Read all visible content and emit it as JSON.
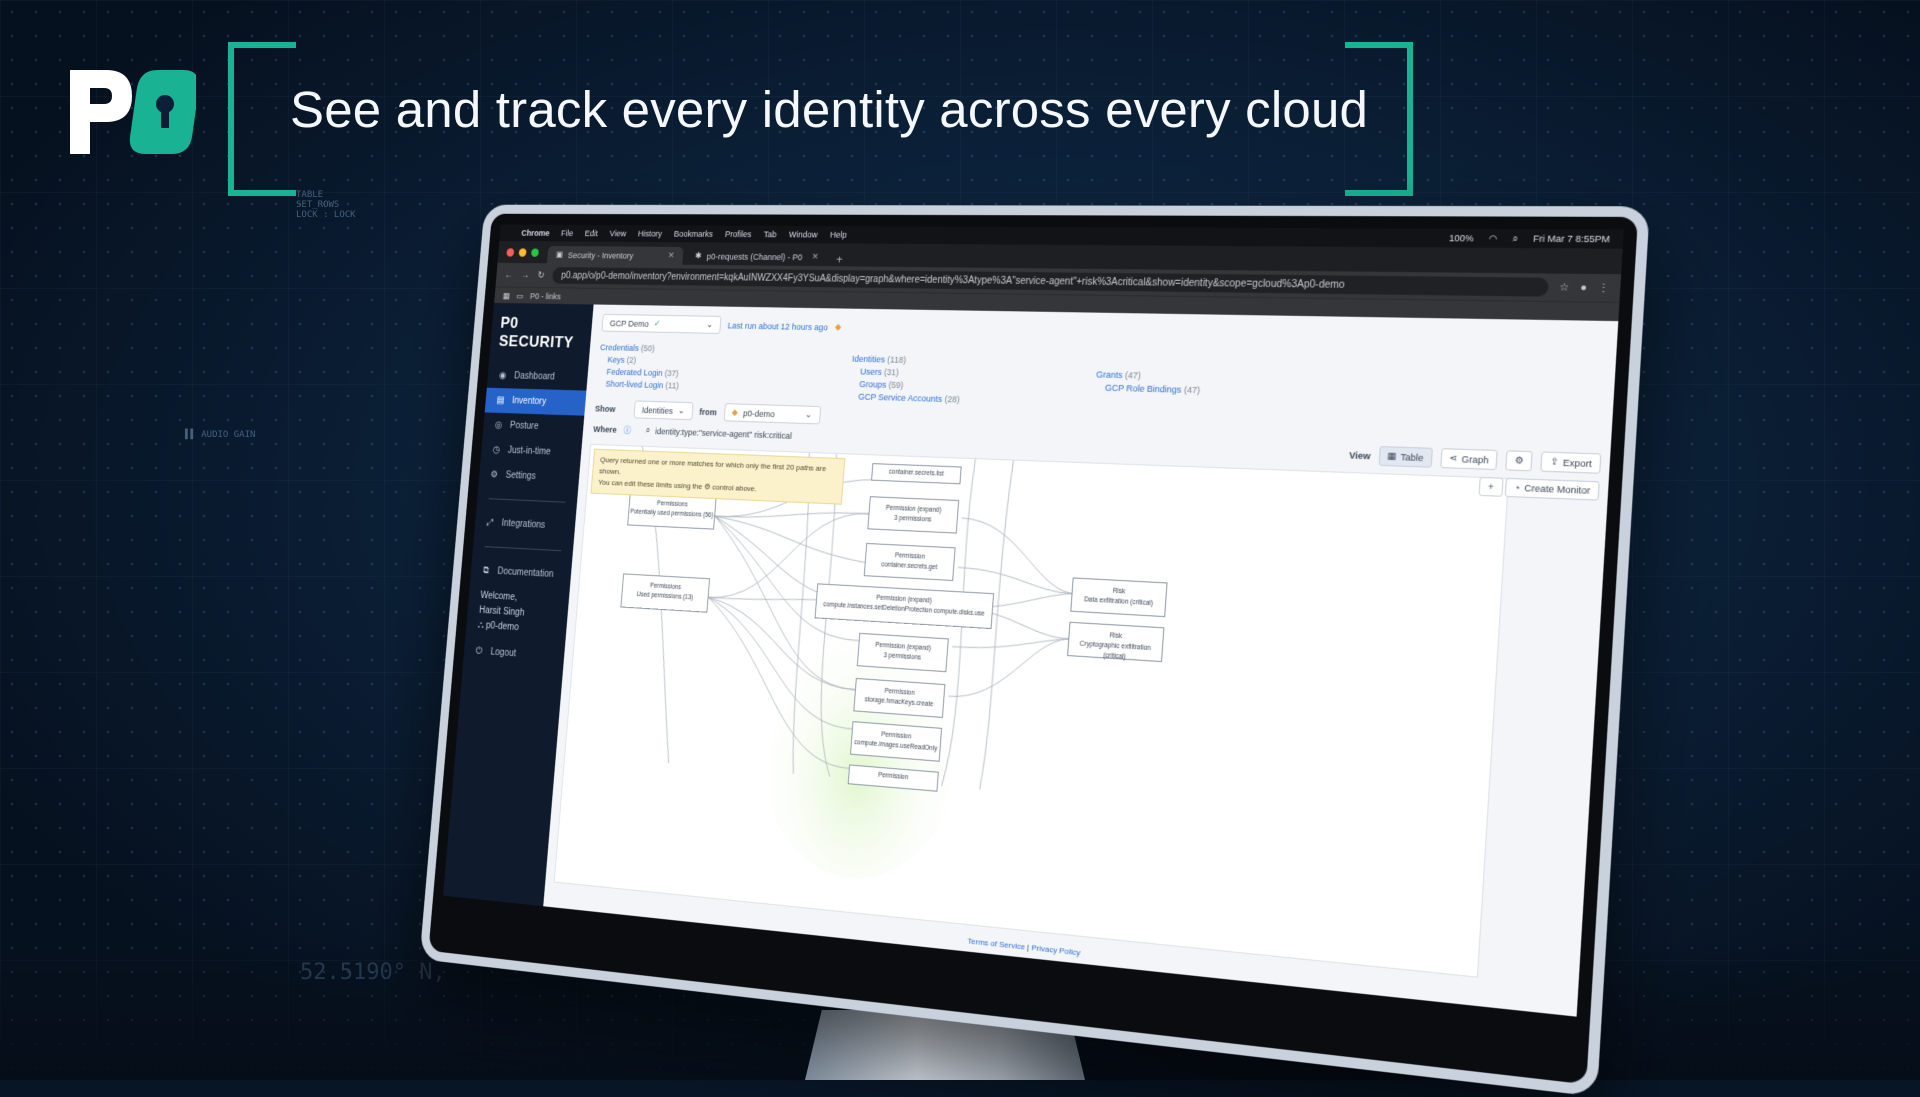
{
  "headline": "See and track every identity across every cloud",
  "logo_text": "P0",
  "colors": {
    "accent": "#19b394",
    "background": "#0b2038",
    "app_nav_active": "#2563c9"
  },
  "mac_menu": {
    "items": [
      "Chrome",
      "File",
      "Edit",
      "View",
      "History",
      "Bookmarks",
      "Profiles",
      "Tab",
      "Window",
      "Help"
    ],
    "datetime": "Fri Mar 7 8:55PM",
    "battery": "100%"
  },
  "browser": {
    "tabs": [
      {
        "title": "Security - Inventory"
      },
      {
        "title": "p0-requests (Channel) - P0"
      }
    ],
    "url": "p0.app/o/p0-demo/inventory?environment=kqkAuINWZXX4Fy3YSuA&display=graph&where=identity%3Atype%3A\"service-agent\"+risk%3Acritical&show=identity&scope=gcloud%3Ap0-demo",
    "bookmark": "P0 - links"
  },
  "app": {
    "brand": "P0 SECURITY",
    "nav": [
      {
        "label": "Dashboard",
        "icon": "dashboard-icon"
      },
      {
        "label": "Inventory",
        "icon": "inventory-icon"
      },
      {
        "label": "Posture",
        "icon": "posture-icon"
      },
      {
        "label": "Just-in-time",
        "icon": "clock-icon"
      },
      {
        "label": "Settings",
        "icon": "gear-icon"
      },
      {
        "label": "Integrations",
        "icon": "integrations-icon"
      },
      {
        "label": "Documentation",
        "icon": "docs-icon"
      }
    ],
    "welcome": "Welcome,",
    "user_name": "Harsit Singh",
    "org": "p0-demo",
    "logout": "Logout"
  },
  "inventory": {
    "environment": "GCP Demo",
    "last_run": "Last run about 12 hours ago",
    "credentials": {
      "label": "Credentials",
      "count": "(50)",
      "items": [
        {
          "label": "Keys",
          "count": "(2)"
        },
        {
          "label": "Federated Login",
          "count": "(37)"
        },
        {
          "label": "Short-lived Login",
          "count": "(11)"
        }
      ]
    },
    "identities": {
      "label": "Identities",
      "count": "(118)",
      "items": [
        {
          "label": "Users",
          "count": "(31)"
        },
        {
          "label": "Groups",
          "count": "(59)"
        },
        {
          "label": "GCP Service Accounts",
          "count": "(28)"
        }
      ]
    },
    "grants": {
      "label": "Grants",
      "count": "(47)",
      "items": [
        {
          "label": "GCP Role Bindings",
          "count": "(47)"
        }
      ]
    },
    "show_label": "Show",
    "show_value": "Identities",
    "from_label": "from",
    "from_value": "p0-demo",
    "where_label": "Where",
    "where_query": "identity:type:\"service-agent\" risk:critical",
    "view_label": "View",
    "view_table": "Table",
    "view_graph": "Graph",
    "export": "Export",
    "create_monitor": "Create Monitor",
    "notice_line1": "Query returned one or more matches for which only the first 20 paths are shown.",
    "notice_line2": "You can edit these limits using the ⚙ control above.",
    "footer_terms": "Terms of Service",
    "footer_privacy": "Privacy Policy"
  },
  "graph_nodes": [
    {
      "title": "Permissions",
      "sub": "Potentially used permissions (56)"
    },
    {
      "title": "Permissions",
      "sub": "Used permissions (13)"
    },
    {
      "title": "container.secrets.list",
      "sub": ""
    },
    {
      "title": "Permission (expand)",
      "sub": "3 permissions"
    },
    {
      "title": "Permission",
      "sub": "container.secrets.get"
    },
    {
      "title": "Permission (expand)",
      "sub": "compute.instances.setDeletionProtection   compute.disks.use"
    },
    {
      "title": "Permission (expand)",
      "sub": "3 permissions"
    },
    {
      "title": "Permission",
      "sub": "storage.hmacKeys.create"
    },
    {
      "title": "Permission",
      "sub": "compute.images.useReadOnly"
    },
    {
      "title": "Permission",
      "sub": ""
    },
    {
      "title": "Risk",
      "sub": "Data exfiltration (critical)"
    },
    {
      "title": "Risk",
      "sub": "Cryptographic exfiltration (critical)"
    }
  ]
}
